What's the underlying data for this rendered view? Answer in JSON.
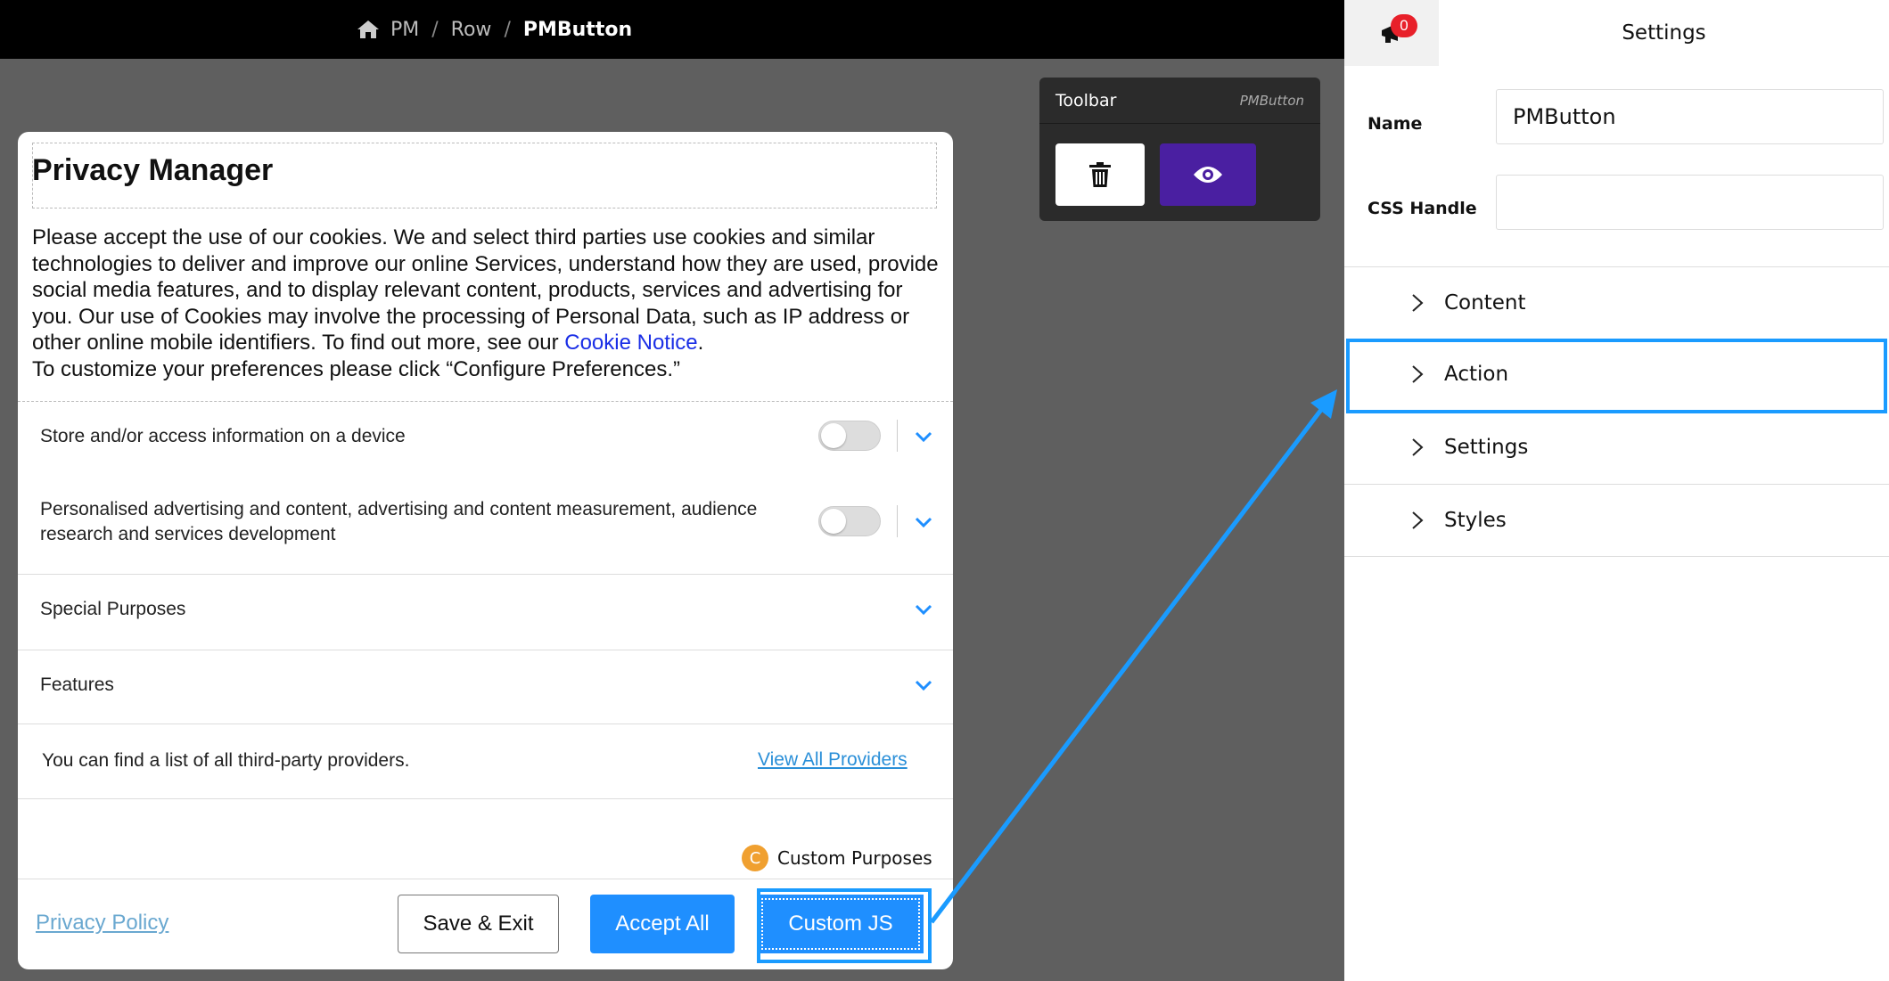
{
  "breadcrumb": {
    "items": [
      "PM",
      "Row",
      "PMButton"
    ],
    "separator": "/"
  },
  "toolbar": {
    "title": "Toolbar",
    "subtitle": "PMButton",
    "delete_icon": "trash-icon",
    "preview_icon": "eye-icon"
  },
  "modal": {
    "title": "Privacy Manager",
    "description_pre": "Please accept the use of our cookies. We and select third parties use cookies and similar technologies to deliver and improve our online Services, understand how they are used, provide social media features, and to display relevant content, products, services and advertising for you. Our use of Cookies may involve the processing of Personal Data, such as IP address or other online mobile identifiers. To find out more, see our ",
    "cookie_link": "Cookie Notice",
    "description_post": ".",
    "description_line2": "To customize your preferences please click “Configure Preferences.”",
    "purposes": [
      {
        "label": "Store and/or access information on a device",
        "enabled": false
      },
      {
        "label": "Personalised advertising and content, advertising and content measurement, audience research and services development",
        "enabled": false
      }
    ],
    "special_purposes": "Special Purposes",
    "features": "Features",
    "providers_text": "You can find a list of all third-party providers.",
    "providers_link": "View All Providers",
    "custom_badge": "C",
    "custom_purposes": "Custom Purposes",
    "privacy_policy": "Privacy Policy",
    "buttons": {
      "save": "Save & Exit",
      "accept": "Accept All",
      "custom": "Custom JS"
    }
  },
  "panel": {
    "title": "Settings",
    "notification_count": "0",
    "name_label": "Name",
    "name_value": "PMButton",
    "css_label": "CSS Handle",
    "css_value": "",
    "sections": [
      "Content",
      "Action",
      "Settings",
      "Styles"
    ]
  },
  "colors": {
    "accent": "#1f8fff",
    "highlight": "#1a9bff",
    "preview_button": "#4a1fa1",
    "canvas": "#5f5f5f",
    "badge": "#e8202a"
  }
}
